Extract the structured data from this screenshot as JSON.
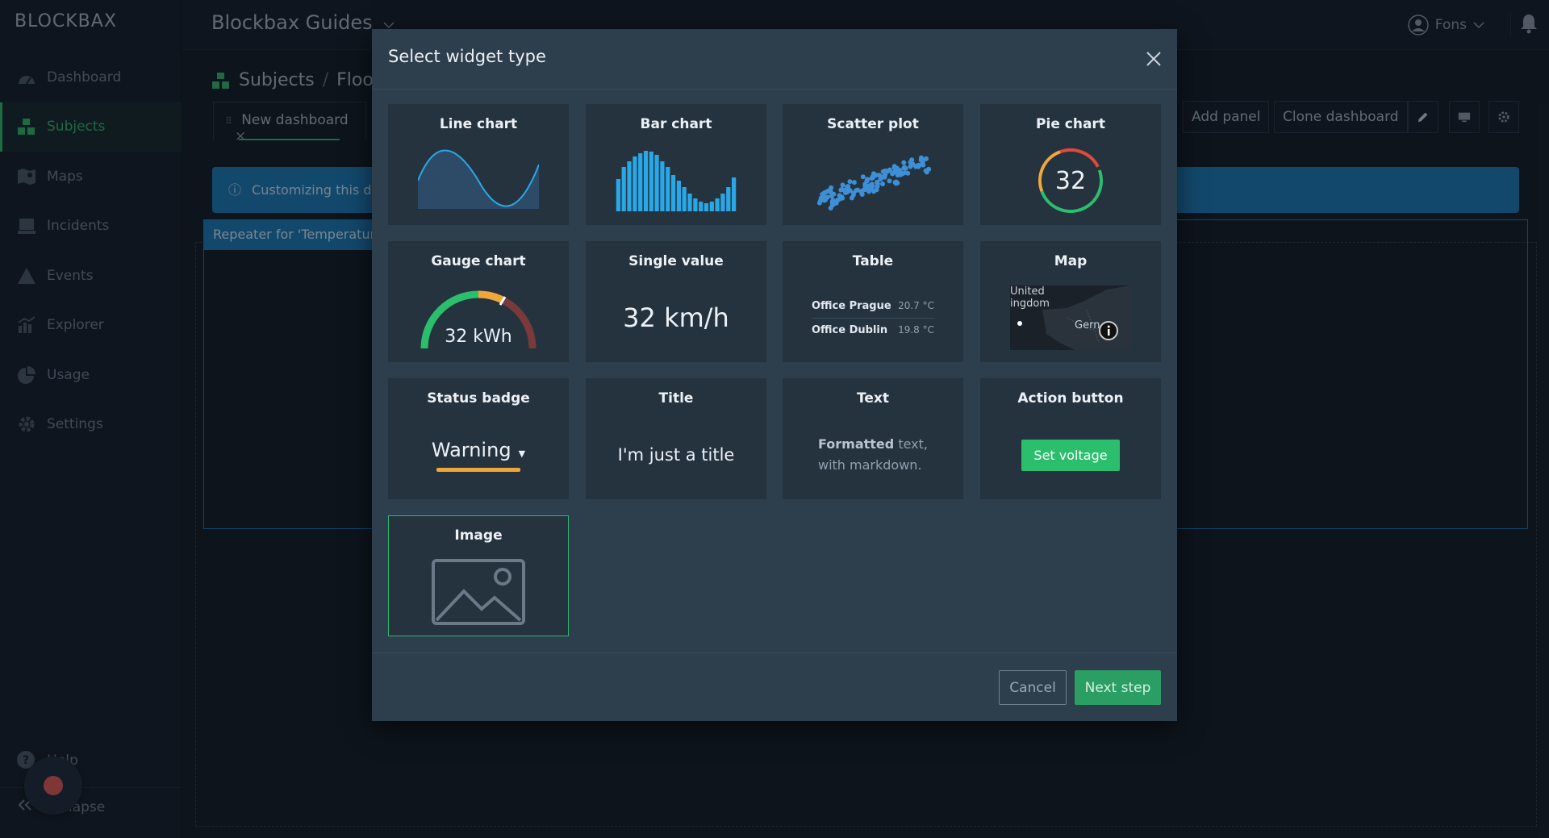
{
  "app": {
    "logo": "BLOCKBAX",
    "title": "Blockbax Guides",
    "user": "Fons"
  },
  "sidebar": {
    "items": [
      {
        "label": "Dashboard",
        "icon": "dashboard-icon"
      },
      {
        "label": "Subjects",
        "icon": "subjects-icon",
        "active": true
      },
      {
        "label": "Maps",
        "icon": "map-icon"
      },
      {
        "label": "Incidents",
        "icon": "incidents-icon"
      },
      {
        "label": "Events",
        "icon": "warning-icon"
      },
      {
        "label": "Explorer",
        "icon": "explorer-icon"
      },
      {
        "label": "Usage",
        "icon": "pie-icon"
      },
      {
        "label": "Settings",
        "icon": "gear-icon"
      }
    ],
    "help": "Help",
    "collapse": "Collapse"
  },
  "page": {
    "breadcrumb": [
      "Subjects",
      "Floo"
    ],
    "tab": "New dashboard",
    "add_panel": "Add panel",
    "clone_dashboard": "Clone dashboard",
    "banner": "Customizing this da",
    "repeater": "Repeater for 'Temperatur"
  },
  "modal": {
    "title": "Select widget type",
    "widgets": [
      {
        "title": "Line chart"
      },
      {
        "title": "Bar chart"
      },
      {
        "title": "Scatter plot"
      },
      {
        "title": "Pie chart",
        "value": "32"
      },
      {
        "title": "Gauge chart",
        "value": "32 kWh"
      },
      {
        "title": "Single value",
        "value": "32 km/h"
      },
      {
        "title": "Table",
        "rows": [
          {
            "name": "Office Prague",
            "value": "20.7 °C"
          },
          {
            "name": "Office Dublin",
            "value": "19.8 °C"
          }
        ]
      },
      {
        "title": "Map",
        "labels": [
          "United\ningdom",
          "Gern"
        ]
      },
      {
        "title": "Status badge",
        "value": "Warning"
      },
      {
        "title": "Title",
        "value": "I'm just a title"
      },
      {
        "title": "Text",
        "value_bold": "Formatted",
        "value_rest": " text,",
        "value_line2": "with markdown."
      },
      {
        "title": "Action button",
        "value": "Set voltage"
      },
      {
        "title": "Image"
      }
    ],
    "cancel": "Cancel",
    "next": "Next step"
  },
  "colors": {
    "accent": "#2fb96c",
    "info": "#1a7ab7",
    "warning": "#f0a73a",
    "chart_blue": "#29a8e8"
  }
}
